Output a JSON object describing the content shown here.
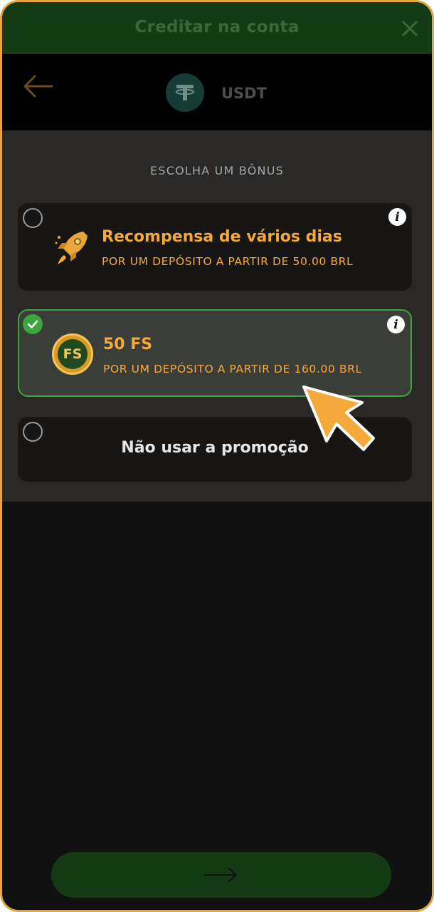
{
  "window": {
    "title": "Creditar na conta"
  },
  "header": {
    "currency": "USDT"
  },
  "bonus_section": {
    "label": "ESCOLHA UM BÔNUS",
    "options": [
      {
        "title": "Recompensa de vários dias",
        "subtitle": "POR UM DEPÓSITO A PARTIR DE 50.00 BRL",
        "icon": "rocket-icon",
        "selected": false
      },
      {
        "title": "50 FS",
        "subtitle": "POR UM DEPÓSITO A PARTIR DE 160.00 BRL",
        "icon": "fs-coin-icon",
        "badge_text": "FS",
        "selected": true
      },
      {
        "title": "Não usar a promoção",
        "selected": false
      }
    ]
  },
  "colors": {
    "accent": "#f5a93a",
    "selected_border": "#3fa33f",
    "frame": "#e3a53b",
    "titlebar": "#153b15"
  },
  "icons": {
    "close": "close-icon",
    "back": "back-arrow-icon",
    "coin": "tether-icon",
    "info": "info-icon",
    "check": "check-icon",
    "next": "arrow-right-icon",
    "pointer": "pointer-arrow-icon"
  }
}
